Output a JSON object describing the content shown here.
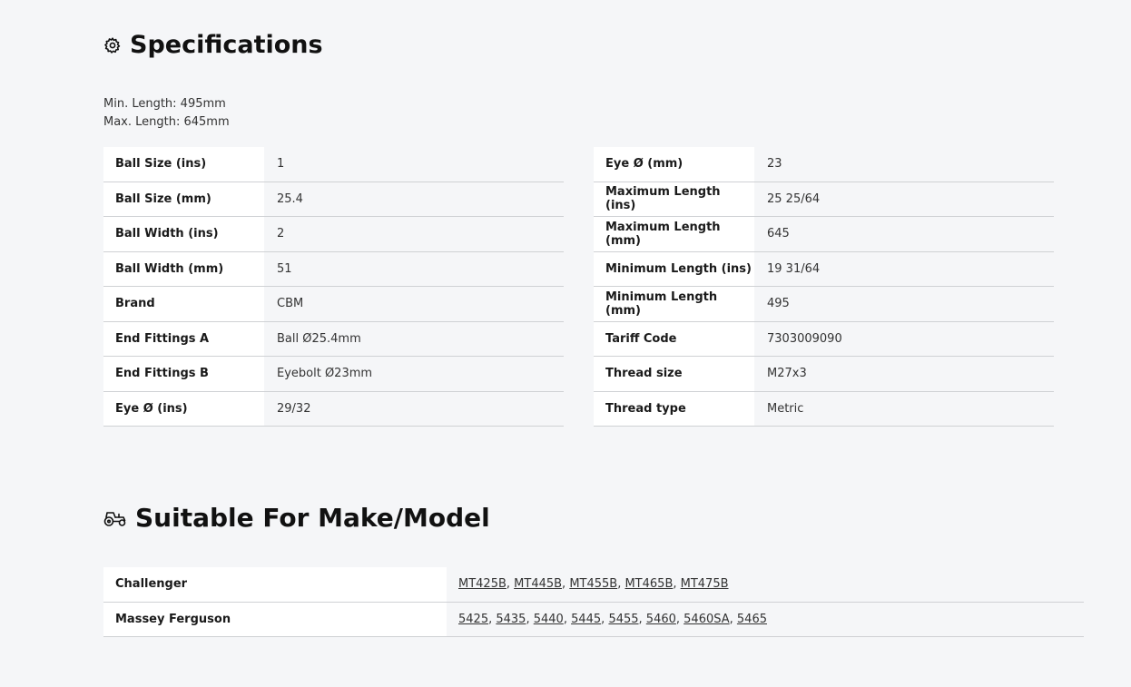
{
  "specifications": {
    "title": "Specifications",
    "min_length": "Min. Length: 495mm",
    "max_length": "Max. Length: 645mm",
    "left_table": [
      {
        "label": "Ball Size (ins)",
        "value": "1"
      },
      {
        "label": "Ball Size (mm)",
        "value": "25.4"
      },
      {
        "label": "Ball Width (ins)",
        "value": "2"
      },
      {
        "label": "Ball Width (mm)",
        "value": "51"
      },
      {
        "label": "Brand",
        "value": "CBM"
      },
      {
        "label": "End Fittings A",
        "value": "Ball Ø25.4mm"
      },
      {
        "label": "End Fittings B",
        "value": "Eyebolt Ø23mm"
      },
      {
        "label": "Eye Ø (ins)",
        "value": "29/32"
      }
    ],
    "right_table": [
      {
        "label": "Eye Ø (mm)",
        "value": "23"
      },
      {
        "label": "Maximum Length (ins)",
        "value": "25 25/64"
      },
      {
        "label": "Maximum Length (mm)",
        "value": "645"
      },
      {
        "label": "Minimum Length (ins)",
        "value": "19 31/64"
      },
      {
        "label": "Minimum Length (mm)",
        "value": "495"
      },
      {
        "label": "Tariff Code",
        "value": "7303009090"
      },
      {
        "label": "Thread size",
        "value": "M27x3"
      },
      {
        "label": "Thread type",
        "value": "Metric"
      }
    ]
  },
  "suitable": {
    "title": "Suitable For Make/Model",
    "rows": [
      {
        "make": "Challenger",
        "models": [
          "MT425B",
          "MT445B",
          "MT455B",
          "MT465B",
          "MT475B"
        ]
      },
      {
        "make": "Massey Ferguson",
        "models": [
          "5425",
          "5435",
          "5440",
          "5445",
          "5455",
          "5460",
          "5460SA",
          "5465"
        ]
      }
    ]
  },
  "icons": {
    "specifications": "gear-icon",
    "suitable": "tractor-icon"
  }
}
